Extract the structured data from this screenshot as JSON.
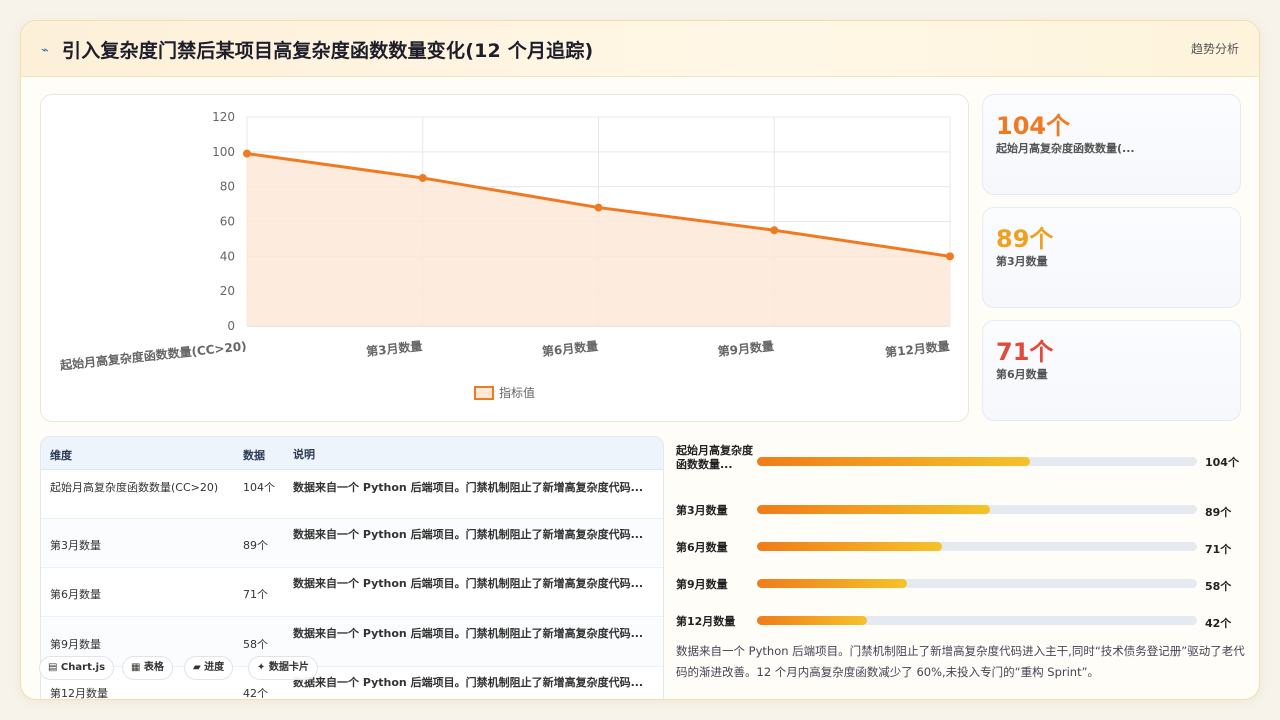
{
  "header": {
    "icon": "trend-line-icon",
    "title": "引入复杂度门禁后某项目高复杂度函数数量变化(12 个月追踪)",
    "tag": "趋势分析"
  },
  "chart_data": {
    "type": "area",
    "categories": [
      "起始月高复杂度函数数量(CC>20)",
      "第3月数量",
      "第6月数量",
      "第9月数量",
      "第12月数量"
    ],
    "series": [
      {
        "name": "指标值",
        "values": [
          99,
          85,
          68,
          55,
          40
        ]
      }
    ],
    "ylim": [
      0,
      120
    ],
    "yticks": [
      0,
      20,
      40,
      60,
      80,
      100,
      120
    ],
    "grid": true,
    "legend": "bottom",
    "colors": {
      "line": "#ef7a22",
      "fill": "#fde8d8"
    }
  },
  "stats": [
    {
      "value": "104个",
      "label": "起始月高复杂度函数数量(...",
      "color": "#ef7a22"
    },
    {
      "value": "89个",
      "label": "第3月数量",
      "color": "#f0a020"
    },
    {
      "value": "71个",
      "label": "第6月数量",
      "color": "#e14a3b"
    }
  ],
  "table": {
    "headers": [
      "维度",
      "数据",
      "说明"
    ],
    "rows": [
      {
        "dim": "起始月高复杂度函数数量(CC>20)",
        "val": "104个",
        "note": "数据来自一个 Python 后端项目。门禁机制阻止了新增高复杂度代码..."
      },
      {
        "dim": "第3月数量",
        "val": "89个",
        "note": "数据来自一个 Python 后端项目。门禁机制阻止了新增高复杂度代码..."
      },
      {
        "dim": "第6月数量",
        "val": "71个",
        "note": "数据来自一个 Python 后端项目。门禁机制阻止了新增高复杂度代码..."
      },
      {
        "dim": "第9月数量",
        "val": "58个",
        "note": "数据来自一个 Python 后端项目。门禁机制阻止了新增高复杂度代码..."
      },
      {
        "dim": "第12月数量",
        "val": "42个",
        "note": "数据来自一个 Python 后端项目。门禁机制阻止了新增高复杂度代码..."
      }
    ]
  },
  "tabs": [
    {
      "icon": "chart-icon",
      "label": "▤ Chart.js"
    },
    {
      "icon": "table-icon",
      "label": "▦ 表格"
    },
    {
      "icon": "progress-icon",
      "label": "▰ 进度"
    },
    {
      "icon": "card-icon",
      "label": "✦ 数据卡片"
    }
  ],
  "progress": {
    "max": 104,
    "items": [
      {
        "label": "起始月高复杂度函数数量...",
        "value": 104,
        "text": "104个",
        "fraction": 0.62
      },
      {
        "label": "第3月数量",
        "value": 89,
        "text": "89个",
        "fraction": 0.53
      },
      {
        "label": "第6月数量",
        "value": 71,
        "text": "71个",
        "fraction": 0.42
      },
      {
        "label": "第9月数量",
        "value": 58,
        "text": "58个",
        "fraction": 0.34
      },
      {
        "label": "第12月数量",
        "value": 42,
        "text": "42个",
        "fraction": 0.25
      }
    ]
  },
  "summary": "数据来自一个 Python 后端项目。门禁机制阻止了新增高复杂度代码进入主干,同时“技术债务登记册”驱动了老代码的渐进改善。12 个月内高复杂度函数减少了 60%,未投入专门的“重构 Sprint”。"
}
